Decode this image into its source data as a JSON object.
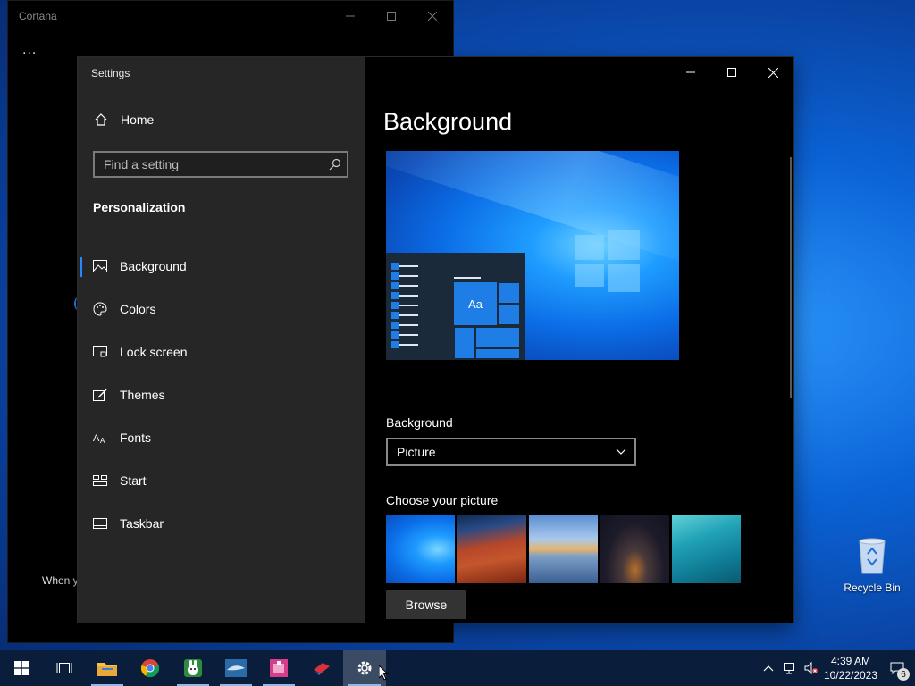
{
  "cortana": {
    "title": "Cortana",
    "dots": "...",
    "partial_text": "When y"
  },
  "settings": {
    "app_title": "Settings",
    "home_label": "Home",
    "search_placeholder": "Find a setting",
    "section_title": "Personalization",
    "nav": [
      {
        "label": "Background",
        "icon": "picture-icon",
        "active": true
      },
      {
        "label": "Colors",
        "icon": "palette-icon"
      },
      {
        "label": "Lock screen",
        "icon": "lock-screen-icon"
      },
      {
        "label": "Themes",
        "icon": "themes-icon"
      },
      {
        "label": "Fonts",
        "icon": "fonts-icon"
      },
      {
        "label": "Start",
        "icon": "start-icon"
      },
      {
        "label": "Taskbar",
        "icon": "taskbar-icon"
      }
    ],
    "page_title": "Background",
    "preview_tile_text": "Aa",
    "background_label": "Background",
    "background_value": "Picture",
    "choose_picture_label": "Choose your picture",
    "browse_label": "Browse"
  },
  "desktop": {
    "recycle_bin_label": "Recycle Bin"
  },
  "taskbar": {
    "time": "4:39 AM",
    "date": "10/22/2023",
    "notification_count": "6"
  },
  "colors": {
    "accent": "#2a86ff",
    "sidebar_bg": "#262626",
    "taskbar_bg": "#0a1d3a"
  }
}
